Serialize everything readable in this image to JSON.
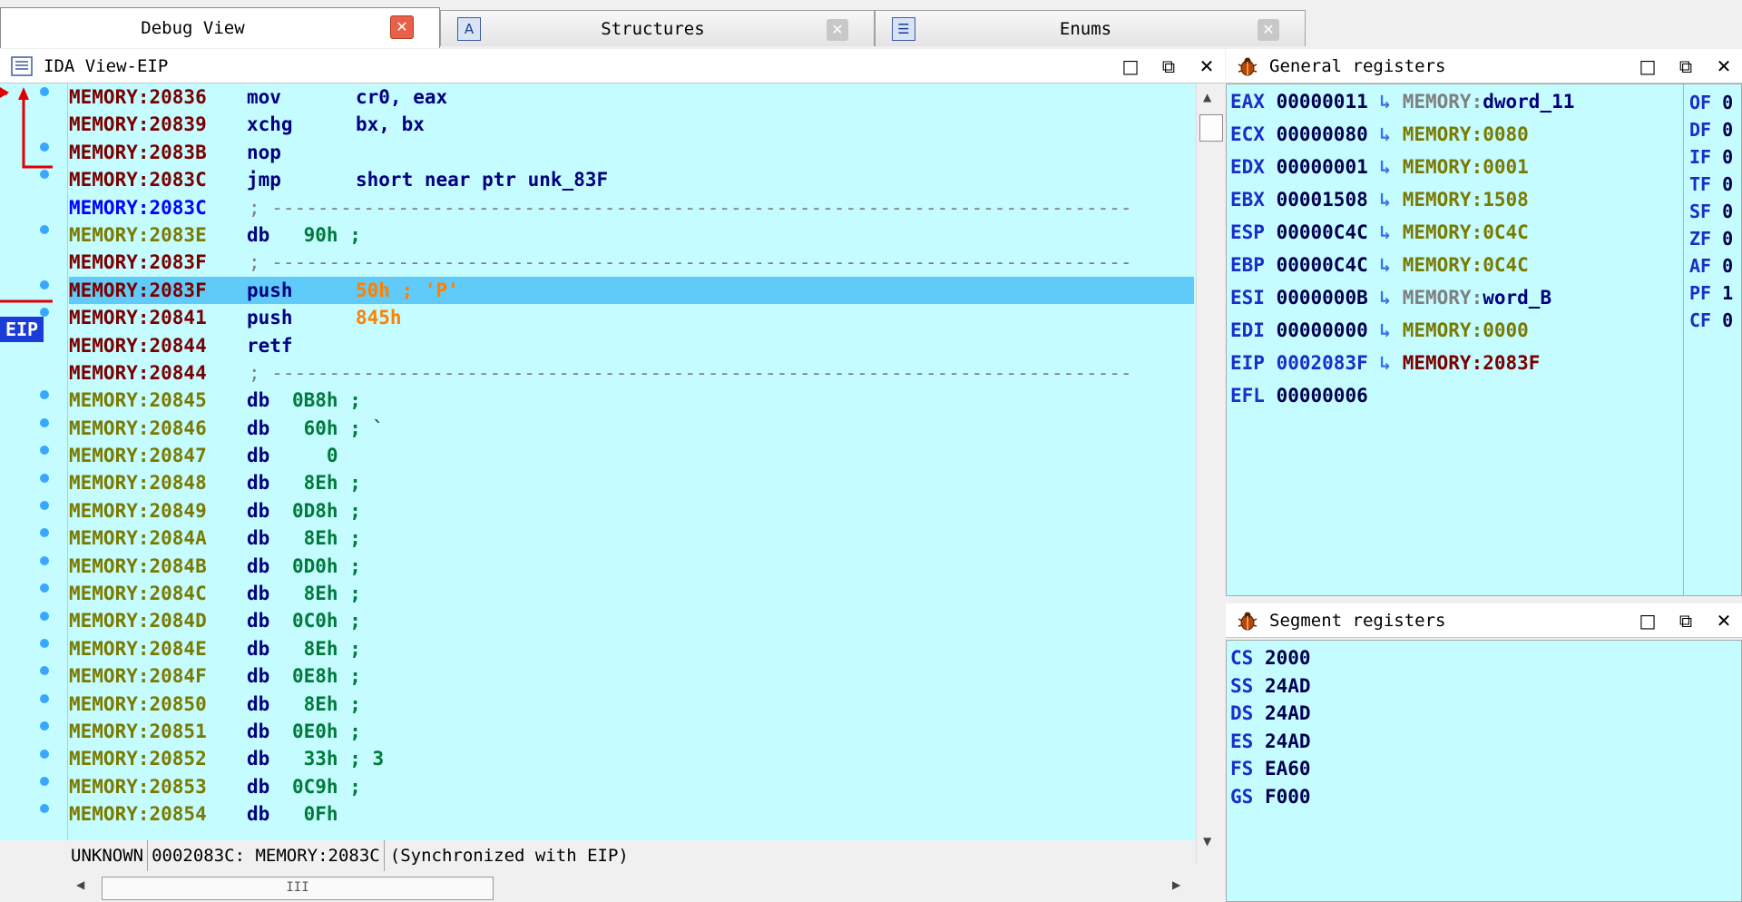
{
  "tabs": [
    {
      "label": "Debug View",
      "active": true
    },
    {
      "label": "Structures",
      "active": false
    },
    {
      "label": "Enums",
      "active": false
    }
  ],
  "ida_view": {
    "title": "IDA View-EIP",
    "eip_marker": "EIP",
    "lines": [
      {
        "addr": "MEMORY:20836",
        "mnem": "mov",
        "ops": "cr0, eax",
        "addr_color": "#7a0000",
        "ops_color": "#00007f"
      },
      {
        "addr": "MEMORY:20839",
        "mnem": "xchg",
        "ops": "bx, bx",
        "addr_color": "#7a0000",
        "ops_color": "#00007f"
      },
      {
        "addr": "MEMORY:2083B",
        "mnem": "nop",
        "ops": "",
        "addr_color": "#7a0000",
        "ops_color": "#00007f"
      },
      {
        "addr": "MEMORY:2083C",
        "mnem": "jmp",
        "ops": "short near ptr unk_83F",
        "addr_color": "#7a0000",
        "ops_color": "#00007f"
      },
      {
        "addr": "MEMORY:2083C",
        "mnem": "",
        "ops": "; ---------------------------------------------------------------------------",
        "addr_color": "#0000ff",
        "ops_color": "#7f7f7f",
        "separator": true
      },
      {
        "addr": "MEMORY:2083E",
        "mnem": "db",
        "ops": " 90h ;",
        "addr_color": "#7a7a00",
        "ops_color": "#007a3a"
      },
      {
        "addr": "MEMORY:2083F",
        "mnem": "",
        "ops": "; ---------------------------------------------------------------------------",
        "addr_color": "#7a0000",
        "ops_color": "#7f7f7f",
        "separator": true
      },
      {
        "addr": "MEMORY:2083F",
        "mnem": "push",
        "ops": "50h ; 'P'",
        "addr_color": "#7a0000",
        "ops_color": "#ff8000",
        "highlight": true
      },
      {
        "addr": "MEMORY:20841",
        "mnem": "push",
        "ops": "845h",
        "addr_color": "#7a0000",
        "ops_color": "#ff8000"
      },
      {
        "addr": "MEMORY:20844",
        "mnem": "retf",
        "ops": "",
        "addr_color": "#7a0000",
        "ops_color": "#00007f"
      },
      {
        "addr": "MEMORY:20844",
        "mnem": "",
        "ops": "; ---------------------------------------------------------------------------",
        "addr_color": "#7a0000",
        "ops_color": "#7f7f7f",
        "separator": true
      },
      {
        "addr": "MEMORY:20845",
        "mnem": "db",
        "ops": "0B8h ;",
        "addr_color": "#7a7a00",
        "ops_color": "#007a3a"
      },
      {
        "addr": "MEMORY:20846",
        "mnem": "db",
        "ops": " 60h ; `",
        "addr_color": "#7a7a00",
        "ops_color": "#007a3a"
      },
      {
        "addr": "MEMORY:20847",
        "mnem": "db",
        "ops": "   0",
        "addr_color": "#7a7a00",
        "ops_color": "#007a3a"
      },
      {
        "addr": "MEMORY:20848",
        "mnem": "db",
        "ops": " 8Eh ;",
        "addr_color": "#7a7a00",
        "ops_color": "#007a3a"
      },
      {
        "addr": "MEMORY:20849",
        "mnem": "db",
        "ops": "0D8h ;",
        "addr_color": "#7a7a00",
        "ops_color": "#007a3a"
      },
      {
        "addr": "MEMORY:2084A",
        "mnem": "db",
        "ops": " 8Eh ;",
        "addr_color": "#7a7a00",
        "ops_color": "#007a3a"
      },
      {
        "addr": "MEMORY:2084B",
        "mnem": "db",
        "ops": "0D0h ;",
        "addr_color": "#7a7a00",
        "ops_color": "#007a3a"
      },
      {
        "addr": "MEMORY:2084C",
        "mnem": "db",
        "ops": " 8Eh ;",
        "addr_color": "#7a7a00",
        "ops_color": "#007a3a"
      },
      {
        "addr": "MEMORY:2084D",
        "mnem": "db",
        "ops": "0C0h ;",
        "addr_color": "#7a7a00",
        "ops_color": "#007a3a"
      },
      {
        "addr": "MEMORY:2084E",
        "mnem": "db",
        "ops": " 8Eh ;",
        "addr_color": "#7a7a00",
        "ops_color": "#007a3a"
      },
      {
        "addr": "MEMORY:2084F",
        "mnem": "db",
        "ops": "0E8h ;",
        "addr_color": "#7a7a00",
        "ops_color": "#007a3a"
      },
      {
        "addr": "MEMORY:20850",
        "mnem": "db",
        "ops": " 8Eh ;",
        "addr_color": "#7a7a00",
        "ops_color": "#007a3a"
      },
      {
        "addr": "MEMORY:20851",
        "mnem": "db",
        "ops": "0E0h ;",
        "addr_color": "#7a7a00",
        "ops_color": "#007a3a"
      },
      {
        "addr": "MEMORY:20852",
        "mnem": "db",
        "ops": " 33h ; 3",
        "addr_color": "#7a7a00",
        "ops_color": "#007a3a"
      },
      {
        "addr": "MEMORY:20853",
        "mnem": "db",
        "ops": "0C9h ;",
        "addr_color": "#7a7a00",
        "ops_color": "#007a3a"
      },
      {
        "addr": "MEMORY:20854",
        "mnem": "db",
        "ops": " 0Fh",
        "addr_color": "#7a7a00",
        "ops_color": "#007a3a"
      }
    ],
    "status": {
      "mode": "UNKNOWN",
      "location": "0002083C: MEMORY:2083C",
      "sync": "(Synchronized with EIP)"
    },
    "hscroll_thumb": "III"
  },
  "general_registers": {
    "title": "General registers",
    "registers": [
      {
        "name": "EAX",
        "value": "00000011",
        "arrow": "↳",
        "target": "MEMORY:dword_11",
        "target_colors": [
          "#7f7f7f",
          "#00007f"
        ]
      },
      {
        "name": "ECX",
        "value": "00000080",
        "arrow": "↳",
        "target": "MEMORY:0080",
        "target_colors": [
          "#7a7a00",
          "#7a7a00"
        ]
      },
      {
        "name": "EDX",
        "value": "00000001",
        "arrow": "↳",
        "target": "MEMORY:0001",
        "target_colors": [
          "#7a7a00",
          "#7a7a00"
        ]
      },
      {
        "name": "EBX",
        "value": "00001508",
        "arrow": "↳",
        "target": "MEMORY:1508",
        "target_colors": [
          "#7a7a00",
          "#7a7a00"
        ]
      },
      {
        "name": "ESP",
        "value": "00000C4C",
        "arrow": "↳",
        "target": "MEMORY:0C4C",
        "target_colors": [
          "#7a7a00",
          "#7a7a00"
        ]
      },
      {
        "name": "EBP",
        "value": "00000C4C",
        "arrow": "↳",
        "target": "MEMORY:0C4C",
        "target_colors": [
          "#7a7a00",
          "#7a7a00"
        ]
      },
      {
        "name": "ESI",
        "value": "0000000B",
        "arrow": "↳",
        "target": "MEMORY:word_B",
        "target_colors": [
          "#7f7f7f",
          "#00007f"
        ]
      },
      {
        "name": "EDI",
        "value": "00000000",
        "arrow": "↳",
        "target": "MEMORY:0000",
        "target_colors": [
          "#7a7a00",
          "#7a7a00"
        ]
      },
      {
        "name": "EIP",
        "value": "0002083F",
        "arrow": "↳",
        "target": "MEMORY:2083F",
        "target_colors": [
          "#7a0000",
          "#7a0000"
        ],
        "value_color": "#1a2ec8"
      },
      {
        "name": "EFL",
        "value": "00000006",
        "arrow": "",
        "target": "",
        "target_colors": [
          "#000",
          "#000"
        ]
      }
    ],
    "flags": [
      {
        "name": "OF",
        "value": "0"
      },
      {
        "name": "DF",
        "value": "0"
      },
      {
        "name": "IF",
        "value": "0"
      },
      {
        "name": "TF",
        "value": "0"
      },
      {
        "name": "SF",
        "value": "0"
      },
      {
        "name": "ZF",
        "value": "0"
      },
      {
        "name": "AF",
        "value": "0"
      },
      {
        "name": "PF",
        "value": "1"
      },
      {
        "name": "CF",
        "value": "0"
      }
    ]
  },
  "segment_registers": {
    "title": "Segment registers",
    "registers": [
      {
        "name": "CS",
        "value": "2000"
      },
      {
        "name": "SS",
        "value": "24AD"
      },
      {
        "name": "DS",
        "value": "24AD"
      },
      {
        "name": "ES",
        "value": "24AD"
      },
      {
        "name": "FS",
        "value": "EA60"
      },
      {
        "name": "GS",
        "value": "F000"
      }
    ]
  },
  "window_buttons": {
    "maximize": "□",
    "restore": "⧉",
    "close": "✕"
  },
  "colors": {
    "listing_bg": "#c4fcff",
    "highlight_bg": "#60cbf8",
    "eip_marker_bg": "#1a3cd8",
    "jump_arrow": "#e00000"
  }
}
